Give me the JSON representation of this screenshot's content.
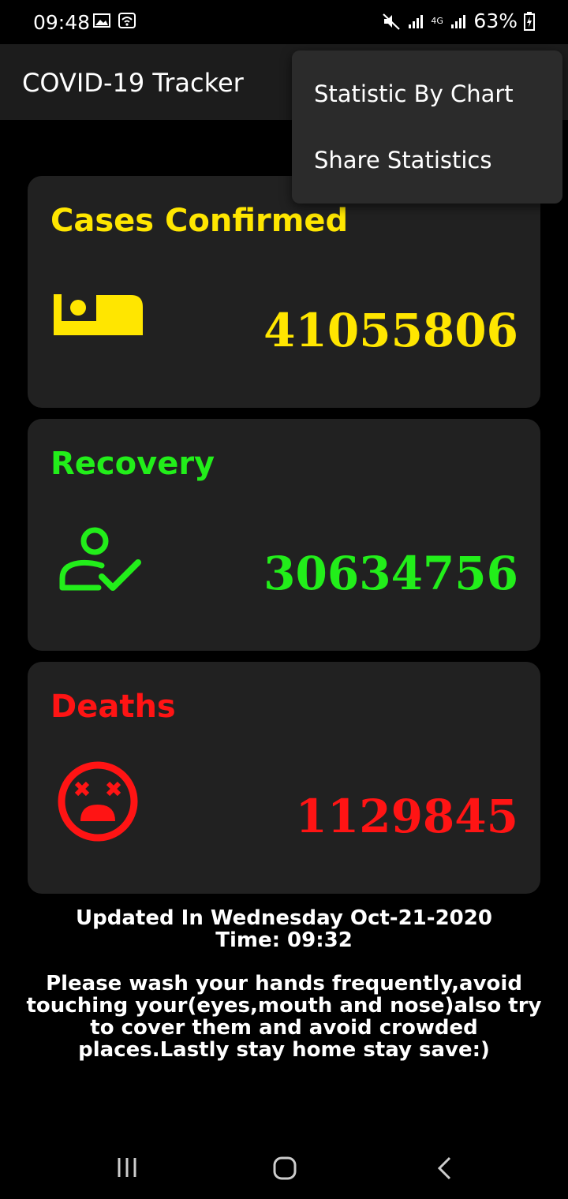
{
  "status_bar": {
    "time": "09:48",
    "battery": "63%",
    "network": "4G"
  },
  "app_bar": {
    "title": "COVID-19 Tracker"
  },
  "overflow_menu": {
    "items": [
      {
        "label": "Statistic By Chart"
      },
      {
        "label": "Share Statistics"
      }
    ]
  },
  "cards": {
    "confirmed": {
      "title": "Cases Confirmed",
      "value": "41055806",
      "color": "#ffe600",
      "icon": "bed-icon"
    },
    "recovery": {
      "title": "Recovery",
      "value": "30634756",
      "color": "#22ee1a",
      "icon": "person-check-icon"
    },
    "deaths": {
      "title": "Deaths",
      "value": "1129845",
      "color": "#ff1414",
      "icon": "dead-face-icon"
    }
  },
  "updated": {
    "line1": "Updated In Wednesday Oct-21-2020",
    "line2": "Time: 09:32"
  },
  "advice": "Please wash your hands frequently,avoid touching your(eyes,mouth and nose)also try to cover them and avoid crowded places.Lastly stay home stay save:)",
  "nav_bar": {
    "recents_icon": "recents-icon",
    "home_icon": "home-icon",
    "back_icon": "back-icon"
  }
}
